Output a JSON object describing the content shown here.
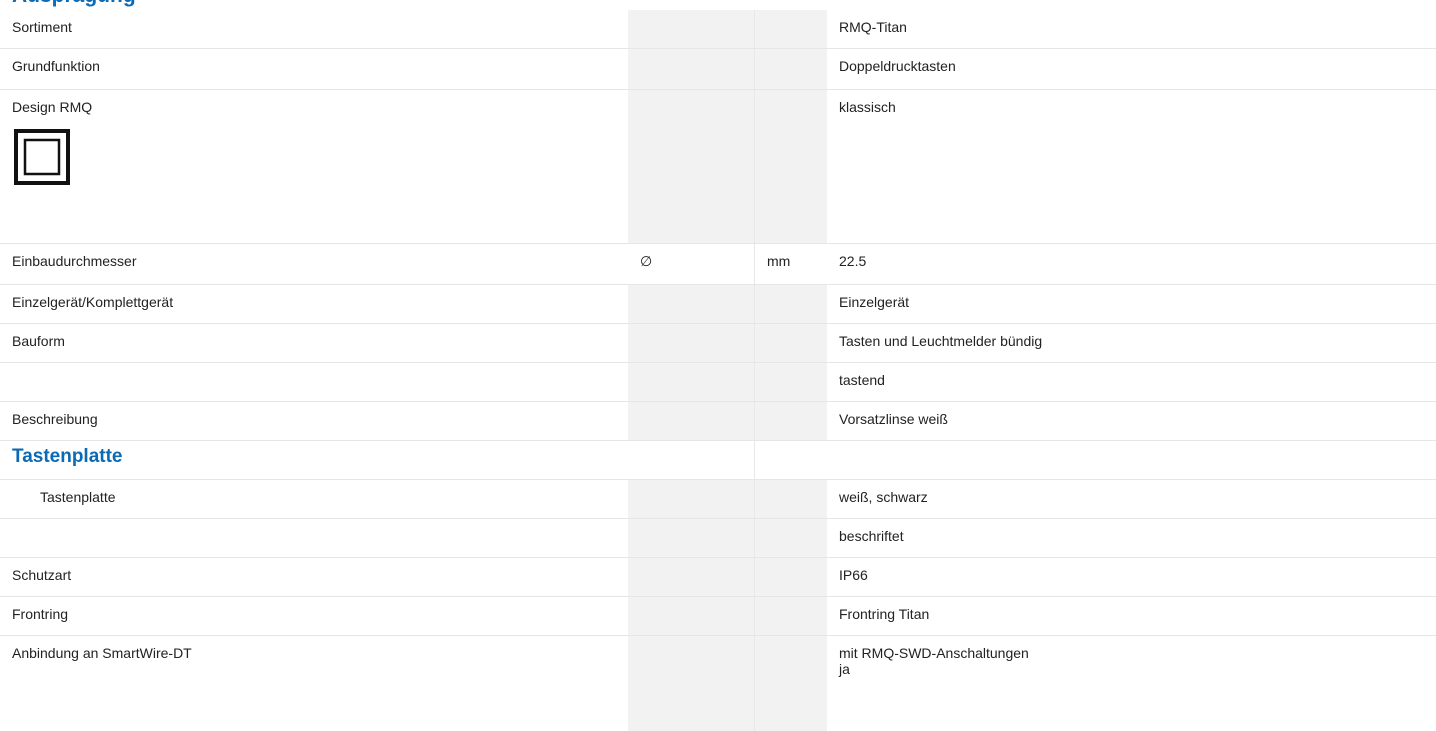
{
  "page": {
    "heading": "Ausprägung"
  },
  "rows": [
    {
      "label": "Sortiment",
      "symbol": "",
      "unit": "",
      "value": "RMQ-Titan"
    },
    {
      "label": "Grundfunktion",
      "symbol": "",
      "unit": "",
      "value": "Doppeldrucktasten"
    },
    {
      "label": "Design RMQ",
      "symbol": "",
      "unit": "",
      "value": "klassisch",
      "icon": "square-bezel-icon"
    },
    {
      "label": "Einbaudurchmesser",
      "symbol": "∅",
      "unit": "mm",
      "value": "22.5"
    },
    {
      "label": "Einzelgerät/Komplettgerät",
      "symbol": "",
      "unit": "",
      "value": "Einzelgerät"
    },
    {
      "label": "Bauform",
      "symbol": "",
      "unit": "",
      "value": "Tasten und Leuchtmelder bündig"
    },
    {
      "label": "",
      "symbol": "",
      "unit": "",
      "value": "tastend"
    },
    {
      "label": "Beschreibung",
      "symbol": "",
      "unit": "",
      "value": "Vorsatzlinse weiß"
    },
    {
      "label": "Tastenplatte",
      "section": true
    },
    {
      "label": "Tastenplatte",
      "symbol": "",
      "unit": "",
      "value": "weiß, schwarz"
    },
    {
      "label": "",
      "symbol": "",
      "unit": "",
      "value": "beschriftet"
    },
    {
      "label": "Schutzart",
      "symbol": "",
      "unit": "",
      "value": "IP66"
    },
    {
      "label": "Frontring",
      "symbol": "",
      "unit": "",
      "value": "Frontring Titan"
    },
    {
      "label": "Anbindung an SmartWire-DT",
      "symbol": "",
      "unit": "",
      "value": "mit RMQ-SWD-Anschaltungen",
      "value2": "ja"
    }
  ],
  "colors": {
    "heading": "#0a6ab6",
    "shaded_column": "#f2f2f2",
    "divider": "#e6e6e6"
  }
}
